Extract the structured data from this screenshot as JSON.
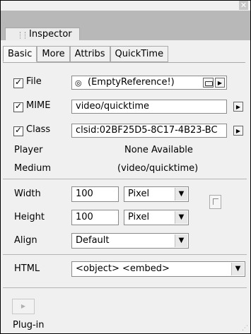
{
  "panel_title": "Inspector",
  "subtabs": [
    "Basic",
    "More",
    "Attribs",
    "QuickTime"
  ],
  "rows": {
    "file": {
      "label": "File",
      "value": "(EmptyReference!)"
    },
    "mime": {
      "label": "MIME",
      "value": "video/quicktime"
    },
    "class": {
      "label": "Class",
      "value": "clsid:02BF25D5-8C17-4B23-BC"
    },
    "player": {
      "label": "Player",
      "value": "None Available"
    },
    "medium": {
      "label": "Medium",
      "value": "(video/quicktime)"
    }
  },
  "size": {
    "width": {
      "label": "Width",
      "value": "100",
      "unit": "Pixel"
    },
    "height": {
      "label": "Height",
      "value": "100",
      "unit": "Pixel"
    }
  },
  "align": {
    "label": "Align",
    "value": "Default"
  },
  "html": {
    "label": "HTML",
    "value": "<object> <embed>"
  },
  "plugin_label": "Plug-in"
}
